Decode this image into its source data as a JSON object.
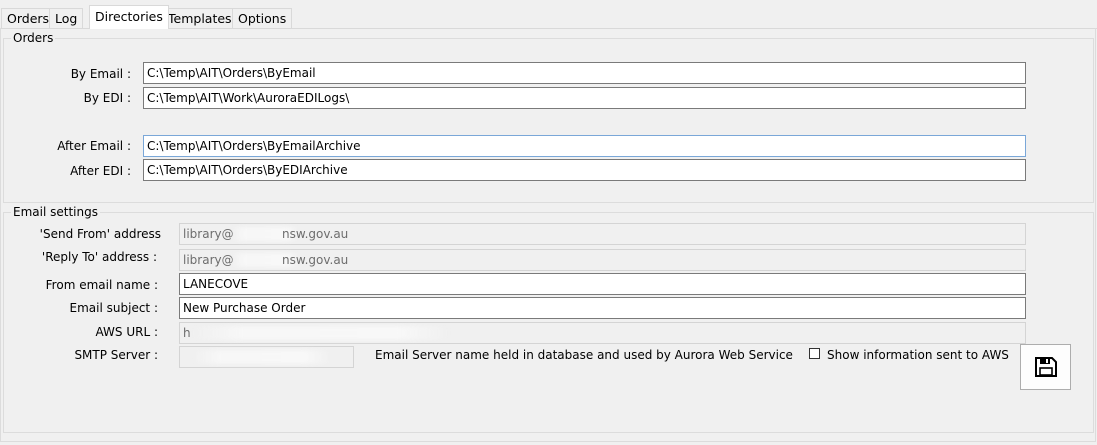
{
  "tabs": [
    "Orders",
    "Log",
    "Directories",
    "Templates",
    "Options"
  ],
  "active_tab": "Directories",
  "orders_group": {
    "title": "Orders",
    "by_email_label": "By Email :",
    "by_email_value": "C:\\Temp\\AIT\\Orders\\ByEmail",
    "by_edi_label": "By EDI :",
    "by_edi_value": "C:\\Temp\\AIT\\Work\\AuroraEDILogs\\",
    "after_email_label": "After Email :",
    "after_email_value": "C:\\Temp\\AIT\\Orders\\ByEmailArchive",
    "after_edi_label": "After EDI :",
    "after_edi_value": "C:\\Temp\\AIT\\Orders\\ByEDIArchive"
  },
  "email_group": {
    "title": "Email settings",
    "send_from_label": "'Send From' address",
    "send_from_prefix": "library@",
    "send_from_suffix": "nsw.gov.au",
    "reply_to_label": "'Reply To' address :",
    "reply_to_prefix": "library@",
    "reply_to_suffix": "nsw.gov.au",
    "from_name_label": "From email name :",
    "from_name_value": "LANECOVE",
    "subject_label": "Email subject :",
    "subject_value": "New Purchase Order",
    "aws_url_label": "AWS URL :",
    "aws_url_value": "h",
    "smtp_label": "SMTP Server :",
    "smtp_note": "Email Server name held in database and used by Aurora Web Service",
    "show_info_label": "Show information sent to AWS",
    "show_info_checked": false
  },
  "icons": {
    "save": "floppy-disk-icon"
  }
}
